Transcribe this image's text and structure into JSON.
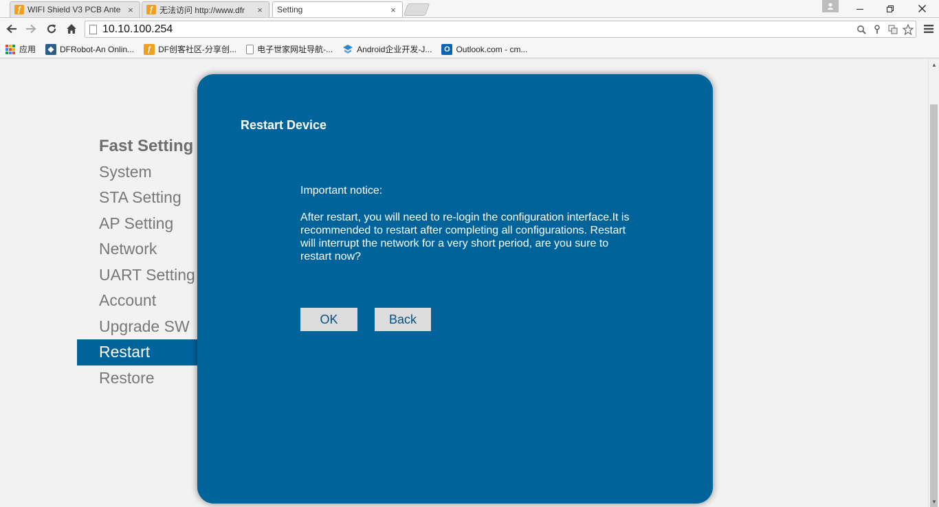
{
  "browser": {
    "tabs": [
      {
        "title": "WIFI Shield V3 PCB Ante",
        "icon": "df-favicon"
      },
      {
        "title": "无法访问 http://www.dfr",
        "icon": "df-favicon"
      },
      {
        "title": "Setting",
        "icon": "page-icon"
      }
    ],
    "tab_close": "×",
    "url": "10.10.100.254",
    "bookmarks": [
      {
        "label": "应用",
        "icon": "apps-icon"
      },
      {
        "label": "DFRobot-An Onlin...",
        "icon": "dfrobot-icon"
      },
      {
        "label": "DF创客社区-分享创...",
        "icon": "df-favicon"
      },
      {
        "label": "电子世家网址导航-...",
        "icon": "page-icon"
      },
      {
        "label": "Android企业开发-J...",
        "icon": "android-dev-icon"
      },
      {
        "label": "Outlook.com - cm...",
        "icon": "outlook-icon"
      }
    ]
  },
  "sidebar": {
    "items": [
      {
        "label": "Fast Setting"
      },
      {
        "label": "System"
      },
      {
        "label": "STA Setting"
      },
      {
        "label": "AP Setting"
      },
      {
        "label": "Network"
      },
      {
        "label": "UART Setting"
      },
      {
        "label": "Account"
      },
      {
        "label": "Upgrade SW"
      },
      {
        "label": "Restart"
      },
      {
        "label": "Restore"
      }
    ],
    "active": "Restart"
  },
  "dialog": {
    "title": "Restart Device",
    "notice_heading": "Important notice:",
    "notice_body": "After restart, you will need to re-login the configuration interface.It is recommended to restart after completing all configurations. Restart will interrupt the network for a very short period, are you sure to restart now?",
    "ok_label": "OK",
    "back_label": "Back"
  },
  "colors": {
    "dialog_bg": "#00649b",
    "nav_active_bg": "#00639a",
    "button_bg": "#dcdcdc",
    "button_text": "#00508a"
  }
}
